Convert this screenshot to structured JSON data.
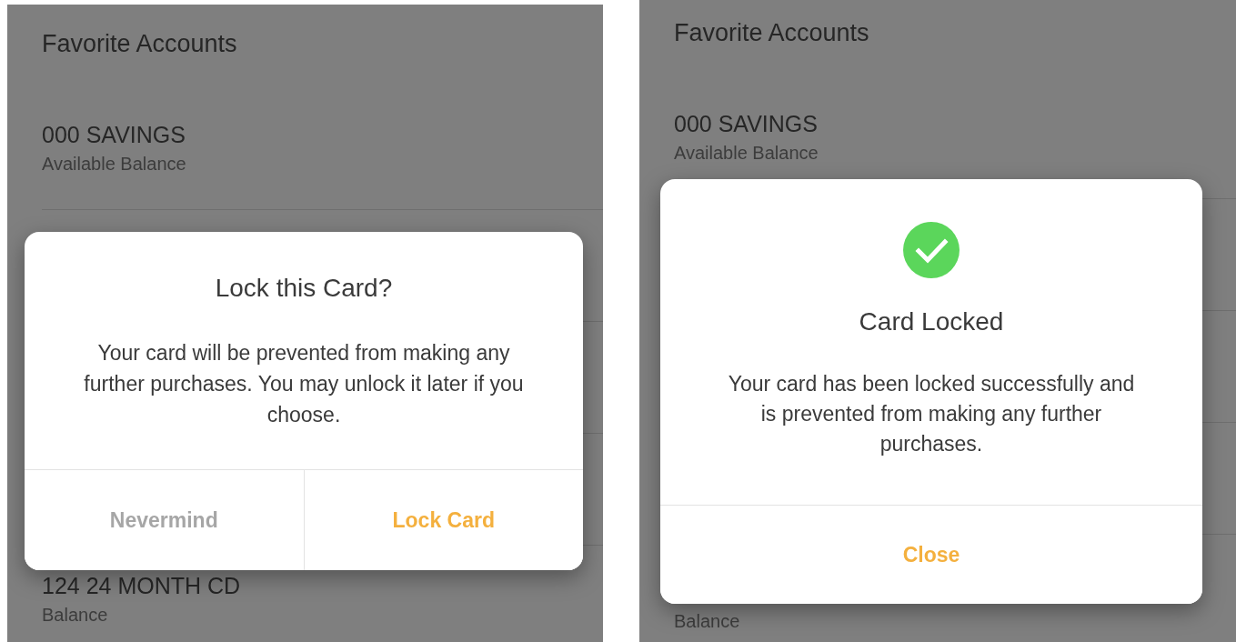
{
  "screens": [
    {
      "kind": "confirm",
      "header": "Favorite Accounts",
      "accounts": [
        {
          "name": "000 SAVINGS",
          "label": "Available Balance"
        },
        {
          "name": "124 24 MONTH CD",
          "label": "Balance"
        }
      ],
      "dialog": {
        "title": "Lock this Card?",
        "message": "Your card will be prevented from making any further purchases. You may unlock it later if you choose.",
        "buttons": [
          {
            "label": "Nevermind",
            "kind": "cancel"
          },
          {
            "label": "Lock Card",
            "kind": "primary"
          }
        ]
      }
    },
    {
      "kind": "success",
      "header": "Favorite Accounts",
      "accounts": [
        {
          "name": "000 SAVINGS",
          "label": "Available Balance"
        },
        {
          "label": "Balance"
        }
      ],
      "dialog": {
        "title": "Card Locked",
        "message": "Your card has been locked successfully and is prevented from making any further purchases.",
        "buttons": [
          {
            "label": "Close",
            "kind": "primary"
          }
        ]
      }
    }
  ]
}
